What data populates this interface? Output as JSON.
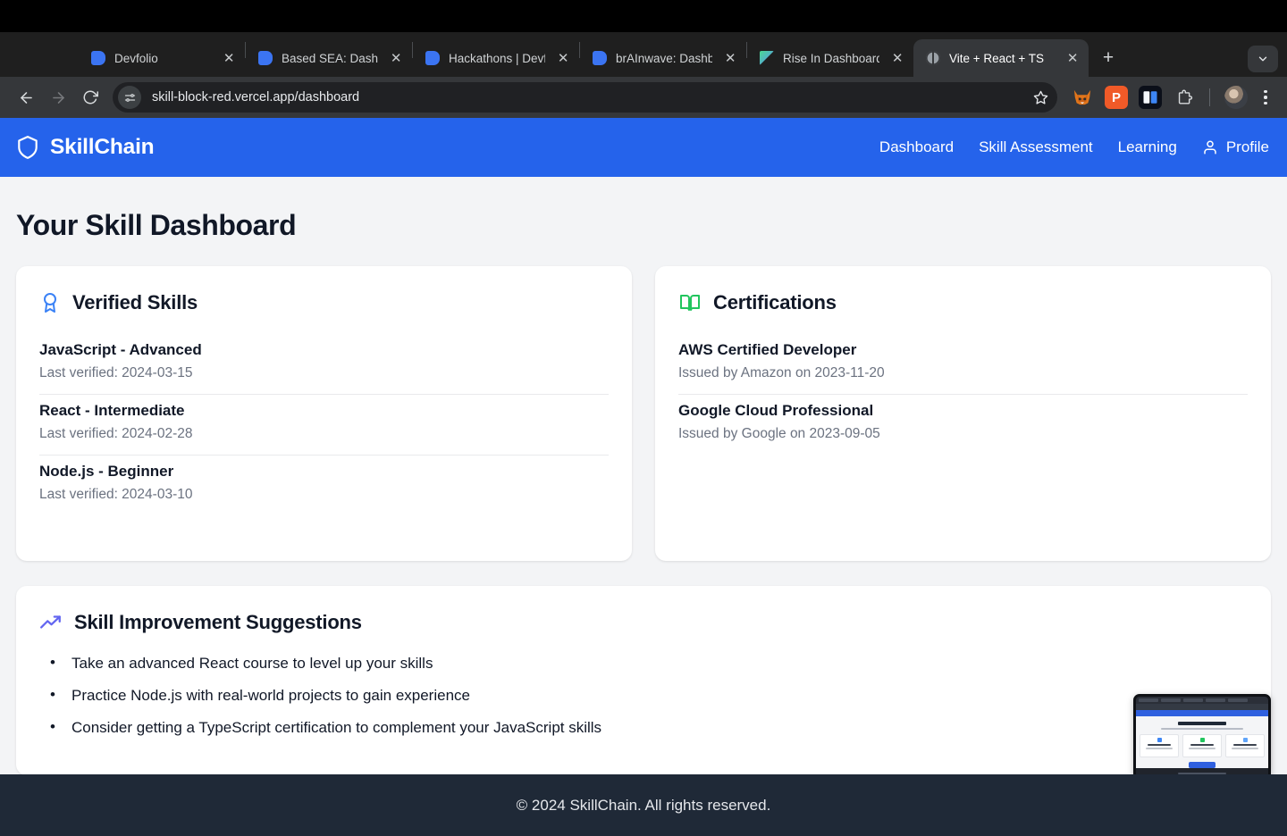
{
  "browser": {
    "tabs": [
      {
        "title": "Devfolio",
        "favicon": "devfolio-icon",
        "active": false
      },
      {
        "title": "Based SEA: Dashbo",
        "favicon": "devfolio-icon",
        "active": false
      },
      {
        "title": "Hackathons | Devfo",
        "favicon": "devfolio-icon",
        "active": false
      },
      {
        "title": "brAInwave: Dashbo",
        "favicon": "devfolio-icon",
        "active": false
      },
      {
        "title": "Rise In Dashboard |",
        "favicon": "rise-in-icon",
        "active": false
      },
      {
        "title": "Vite + React + TS",
        "favicon": "globe-icon",
        "active": true
      }
    ],
    "close_label": "✕",
    "new_tab_label": "+",
    "url": "skill-block-red.vercel.app/dashboard",
    "toolbar": {
      "back": "←",
      "forward": "→",
      "reload": "↻",
      "star": "☆",
      "extension_orange_label": "P"
    }
  },
  "site": {
    "brand": "SkillChain",
    "nav": [
      {
        "label": "Dashboard"
      },
      {
        "label": "Skill Assessment"
      },
      {
        "label": "Learning"
      }
    ],
    "profile_label": "Profile",
    "page_title": "Your Skill Dashboard",
    "footer": "© 2024 SkillChain. All rights reserved.",
    "colors": {
      "brand_blue": "#2563eb",
      "page_bg": "#f3f4f6",
      "card_bg": "#ffffff",
      "footer_bg": "#1f2937",
      "verified_icon": "#3b82f6",
      "certification_icon": "#22c55e",
      "suggestion_icon": "#6366f1"
    }
  },
  "verified_skills": {
    "title": "Verified Skills",
    "icon": "award-icon",
    "items": [
      {
        "name": "JavaScript - Advanced",
        "meta": "Last verified: 2024-03-15"
      },
      {
        "name": "React - Intermediate",
        "meta": "Last verified: 2024-02-28"
      },
      {
        "name": "Node.js - Beginner",
        "meta": "Last verified: 2024-03-10"
      }
    ]
  },
  "certifications": {
    "title": "Certifications",
    "icon": "book-open-icon",
    "items": [
      {
        "name": "AWS Certified Developer",
        "meta": "Issued by Amazon on 2023-11-20"
      },
      {
        "name": "Google Cloud Professional",
        "meta": "Issued by Google on 2023-09-05"
      }
    ]
  },
  "suggestions": {
    "title": "Skill Improvement Suggestions",
    "icon": "trending-up-icon",
    "items": [
      "Take an advanced React course to level up your skills",
      "Practice Node.js with real-world projects to gain experience",
      "Consider getting a TypeScript certification to complement your JavaScript skills"
    ]
  }
}
